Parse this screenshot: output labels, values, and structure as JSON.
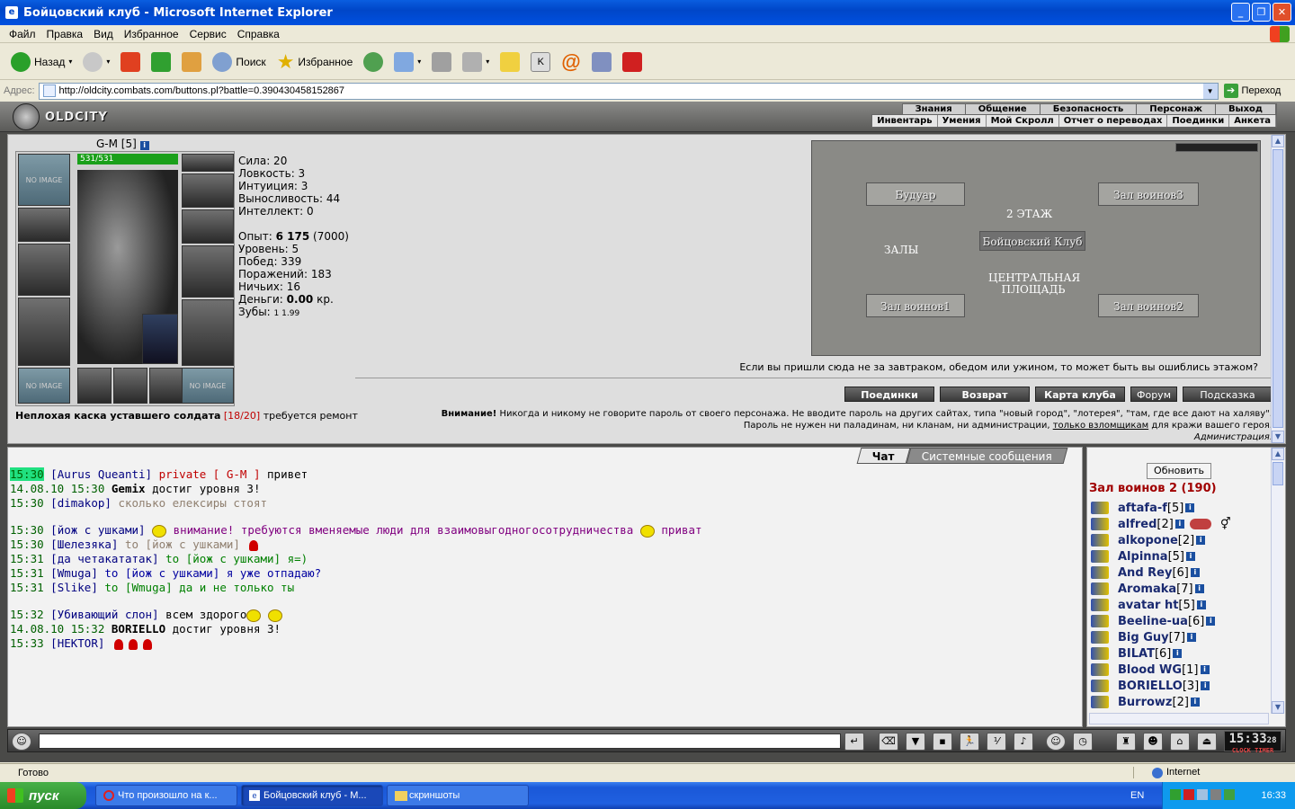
{
  "window": {
    "title": "Бойцовский клуб - Microsoft Internet Explorer"
  },
  "menu": [
    "Файл",
    "Правка",
    "Вид",
    "Избранное",
    "Сервис",
    "Справка"
  ],
  "toolbar": {
    "back": "Назад",
    "search": "Поиск",
    "favorites": "Избранное"
  },
  "address": {
    "label": "Адрес:",
    "url": "http://oldcity.combats.com/buttons.pl?battle=0.390430458152867",
    "go": "Переход"
  },
  "game": {
    "logo": "OLDCITY",
    "nav_top": [
      "Знания",
      "Общение",
      "Безопасность",
      "Персонаж",
      "Выход"
    ],
    "nav_sub": [
      "Инвентарь",
      "Умения",
      "Мой Скролл",
      "Отчет о переводах",
      "Поединки",
      "Анкета"
    ],
    "character": {
      "name": "G-M [5]",
      "hp": "531/531",
      "no_image": "NO IMAGE",
      "stats": {
        "strength": "Сила: 20",
        "agility": "Ловкость: 3",
        "intuition": "Интуиция: 3",
        "endurance": "Выносливость: 44",
        "intellect": "Интеллект: 0",
        "exp_label": "Опыт:",
        "exp_value": "6 175",
        "exp_next": "(7000)",
        "level": "Уровень: 5",
        "wins": "Побед: 339",
        "losses": "Поражений: 183",
        "draws": "Ничьих: 16",
        "money_label": "Деньги:",
        "money_value": "0.00",
        "money_unit": "кр.",
        "teeth_label": "Зубы:",
        "teeth_value": "1  1.99"
      },
      "item_note_bold": "Неплохая каска уставшего солдата",
      "item_note_dur": "[18/20]",
      "item_note_rest": "требуется ремонт"
    },
    "map": {
      "floor": "2 ЭТАЖ",
      "rooms": [
        "Будуар",
        "Зал воинов3",
        "ЗАЛЫ",
        "Бойцовский Клуб",
        "ЦЕНТРАЛЬНАЯ ПЛОЩАДЬ",
        "Зал воинов1",
        "Зал воинов2"
      ],
      "hint": "Если вы пришли сюда не за завтраком, обедом или ужином, то может быть вы ошиблись этажом?"
    },
    "buttons": [
      "Поединки",
      "Возврат",
      "Карта клуба",
      "Форум",
      "Подсказка"
    ],
    "warning": {
      "bold": "Внимание!",
      "line1": "Никогда и никому не говорите пароль от своего персонажа. Не вводите пароль на других сайтах, типа \"новый город\", \"лотерея\", \"там, где все дают на халяву\".",
      "line2a": "Пароль не нужен ни паладинам, ни кланам, ни администрации,",
      "line2u": "только взломщикам",
      "line2b": "для кражи вашего героя.",
      "sign": "Администрация."
    },
    "chat": {
      "tabs": [
        "Чат",
        "Системные сообщения"
      ],
      "lines": [
        {
          "time": "15:30",
          "nick": "[Aurus Queanti]",
          "tag": "private [ G-M ]",
          "text": "привет"
        },
        {
          "time": "14.08.10 15:30",
          "nick": "Gemix",
          "text": "достиг уровня 3!"
        },
        {
          "time": "15:30",
          "nick": "[dimakop]",
          "text": "сколько елексиры стоят"
        },
        {
          "time": "15:30",
          "nick": "[йож с ушками]",
          "text": "внимание! требуются вменяемые люди для взаимовыгодногосотрудничества",
          "text2": "приват"
        },
        {
          "time": "15:30",
          "nick": "[Шелезяка]",
          "to": "to [йож с ушками]"
        },
        {
          "time": "15:31",
          "nick": "[да четакататак]",
          "text": "to [йож с ушками] я=)"
        },
        {
          "time": "15:31",
          "nick": "[Wmuga]",
          "text": "to [йож с ушками] я уже отпадаю?"
        },
        {
          "time": "15:31",
          "nick": "[Slike]",
          "text": "to [Wmuga] да и не только ты"
        },
        {
          "time": "15:32",
          "nick": "[Убивающий слон]",
          "text": "всем здорого"
        },
        {
          "time": "14.08.10 15:32",
          "nick": "BORIELLO",
          "text": "достиг уровня 3!"
        },
        {
          "time": "15:33",
          "nick": "[HEKTOR]"
        }
      ]
    },
    "who": {
      "refresh": "Обновить",
      "room": "Зал воинов 2 (190)",
      "users": [
        {
          "name": "aftafa-f",
          "lvl": "[5]"
        },
        {
          "name": "alfred",
          "lvl": "[2]"
        },
        {
          "name": "alkopone",
          "lvl": "[2]"
        },
        {
          "name": "Alpinna",
          "lvl": "[5]"
        },
        {
          "name": "And Rey",
          "lvl": "[6]"
        },
        {
          "name": "Aromaka",
          "lvl": "[7]"
        },
        {
          "name": "avatar ht",
          "lvl": "[5]"
        },
        {
          "name": "Beeline-ua",
          "lvl": "[6]"
        },
        {
          "name": "Big Guy",
          "lvl": "[7]"
        },
        {
          "name": "BILAT",
          "lvl": "[6]"
        },
        {
          "name": "Blood WG",
          "lvl": "[1]"
        },
        {
          "name": "BORIELLO",
          "lvl": "[3]"
        },
        {
          "name": "Burrowz",
          "lvl": "[2]"
        }
      ]
    },
    "clock": {
      "time": "15:33",
      "sec": "28",
      "label": "CLOCK TIMER"
    }
  },
  "status": {
    "left": "Готово",
    "zone": "Internet"
  },
  "taskbar": {
    "start": "пуск",
    "tasks": [
      "Что произошло на к...",
      "Бойцовский клуб - М...",
      "скриншоты"
    ],
    "lang": "EN",
    "time": "16:33"
  }
}
